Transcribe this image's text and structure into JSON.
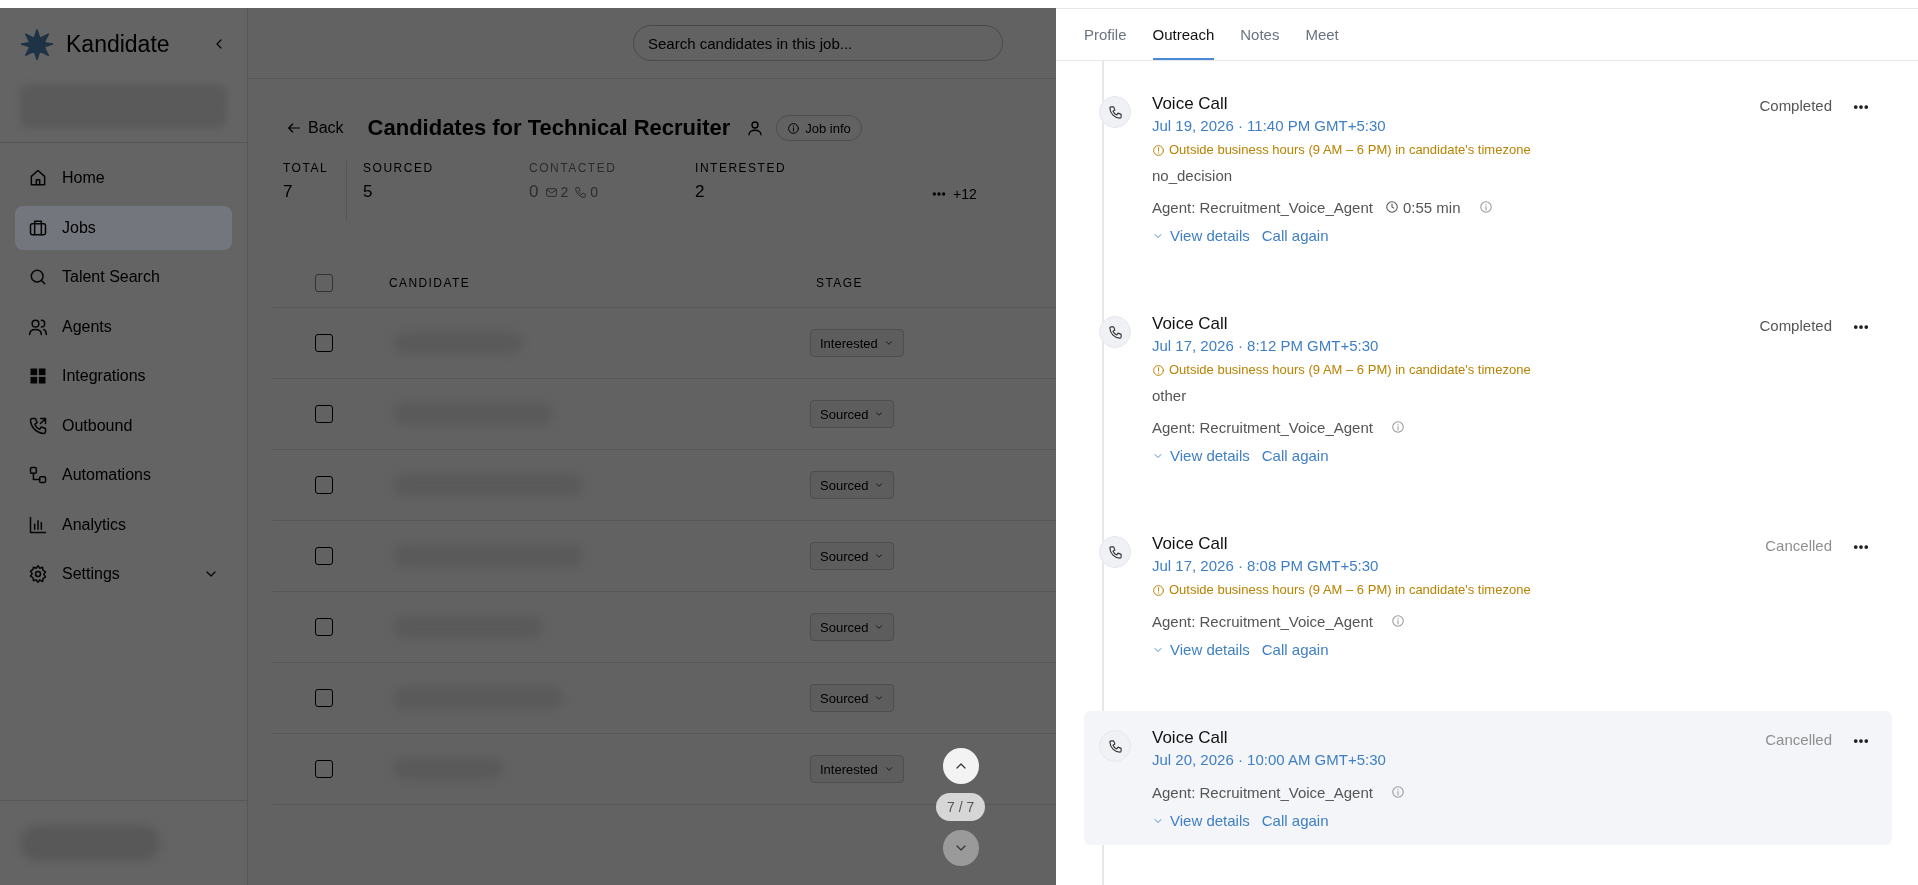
{
  "sidebar": {
    "brand": "Kandidate",
    "items": [
      {
        "label": "Home",
        "kind": "link",
        "selected": false
      },
      {
        "label": "Jobs",
        "kind": "link",
        "selected": true
      },
      {
        "label": "Talent Search",
        "kind": "link",
        "selected": false
      },
      {
        "label": "Agents",
        "kind": "link",
        "selected": false
      },
      {
        "label": "Integrations",
        "kind": "link",
        "selected": false
      },
      {
        "label": "Outbound",
        "kind": "link",
        "selected": false
      },
      {
        "label": "Automations",
        "kind": "link",
        "selected": false
      },
      {
        "label": "Analytics",
        "kind": "link",
        "selected": false
      },
      {
        "label": "Settings",
        "kind": "group",
        "selected": false,
        "expanded": false
      }
    ]
  },
  "main": {
    "search": {
      "placeholder": "Search candidates in this job..."
    },
    "back": "Back",
    "title": "Candidates for Technical Recruiter",
    "job_info": "Job info",
    "stats": [
      {
        "label": "TOTAL",
        "value": "7",
        "muted": false
      },
      {
        "label": "SOURCED",
        "value": "5",
        "muted": false
      },
      {
        "label": "CONTACTED",
        "value": "0",
        "muted": true,
        "sub_counts": [
          "2",
          "0"
        ]
      },
      {
        "label": "INTERESTED",
        "value": "2",
        "muted": false
      }
    ],
    "more": "+12",
    "table": {
      "select_all": {
        "checked": false
      },
      "columns": [
        "CANDIDATE",
        "STAGE"
      ],
      "rows": [
        {
          "checked": false,
          "stage": "Interested"
        },
        {
          "checked": false,
          "stage": "Sourced"
        },
        {
          "checked": false,
          "stage": "Sourced"
        },
        {
          "checked": false,
          "stage": "Sourced"
        },
        {
          "checked": false,
          "stage": "Sourced"
        },
        {
          "checked": false,
          "stage": "Sourced"
        },
        {
          "checked": false,
          "stage": "Interested"
        }
      ]
    },
    "pager": {
      "position": "7 / 7",
      "prev_disabled": false,
      "next_disabled": true
    }
  },
  "panel": {
    "tabs": [
      {
        "label": "Profile",
        "selected": false
      },
      {
        "label": "Outreach",
        "selected": true
      },
      {
        "label": "Notes",
        "selected": false
      },
      {
        "label": "Meet",
        "selected": false
      }
    ],
    "entries": [
      {
        "title": "Voice Call",
        "datetime": "Jul 19, 2026 · 11:40 PM GMT+5:30",
        "warning": "Outside business hours (9 AM – 6 PM) in candidate's timezone",
        "outcome": "no_decision",
        "agent": "Agent: Recruitment_Voice_Agent",
        "duration": "0:55 min",
        "status": "Completed",
        "status_muted": false,
        "highlighted": false,
        "actions": [
          "View details",
          "Call again"
        ]
      },
      {
        "title": "Voice Call",
        "datetime": "Jul 17, 2026 · 8:12 PM GMT+5:30",
        "warning": "Outside business hours (9 AM – 6 PM) in candidate's timezone",
        "outcome": "other",
        "agent": "Agent: Recruitment_Voice_Agent",
        "status": "Completed",
        "status_muted": false,
        "highlighted": false,
        "actions": [
          "View details",
          "Call again"
        ]
      },
      {
        "title": "Voice Call",
        "datetime": "Jul 17, 2026 · 8:08 PM GMT+5:30",
        "warning": "Outside business hours (9 AM – 6 PM) in candidate's timezone",
        "agent": "Agent: Recruitment_Voice_Agent",
        "status": "Cancelled",
        "status_muted": true,
        "highlighted": false,
        "actions": [
          "View details",
          "Call again"
        ]
      },
      {
        "title": "Voice Call",
        "datetime": "Jul 20, 2026 · 10:00 AM GMT+5:30",
        "agent": "Agent: Recruitment_Voice_Agent",
        "status": "Cancelled",
        "status_muted": true,
        "highlighted": true,
        "actions": [
          "View details",
          "Call again"
        ]
      }
    ]
  }
}
